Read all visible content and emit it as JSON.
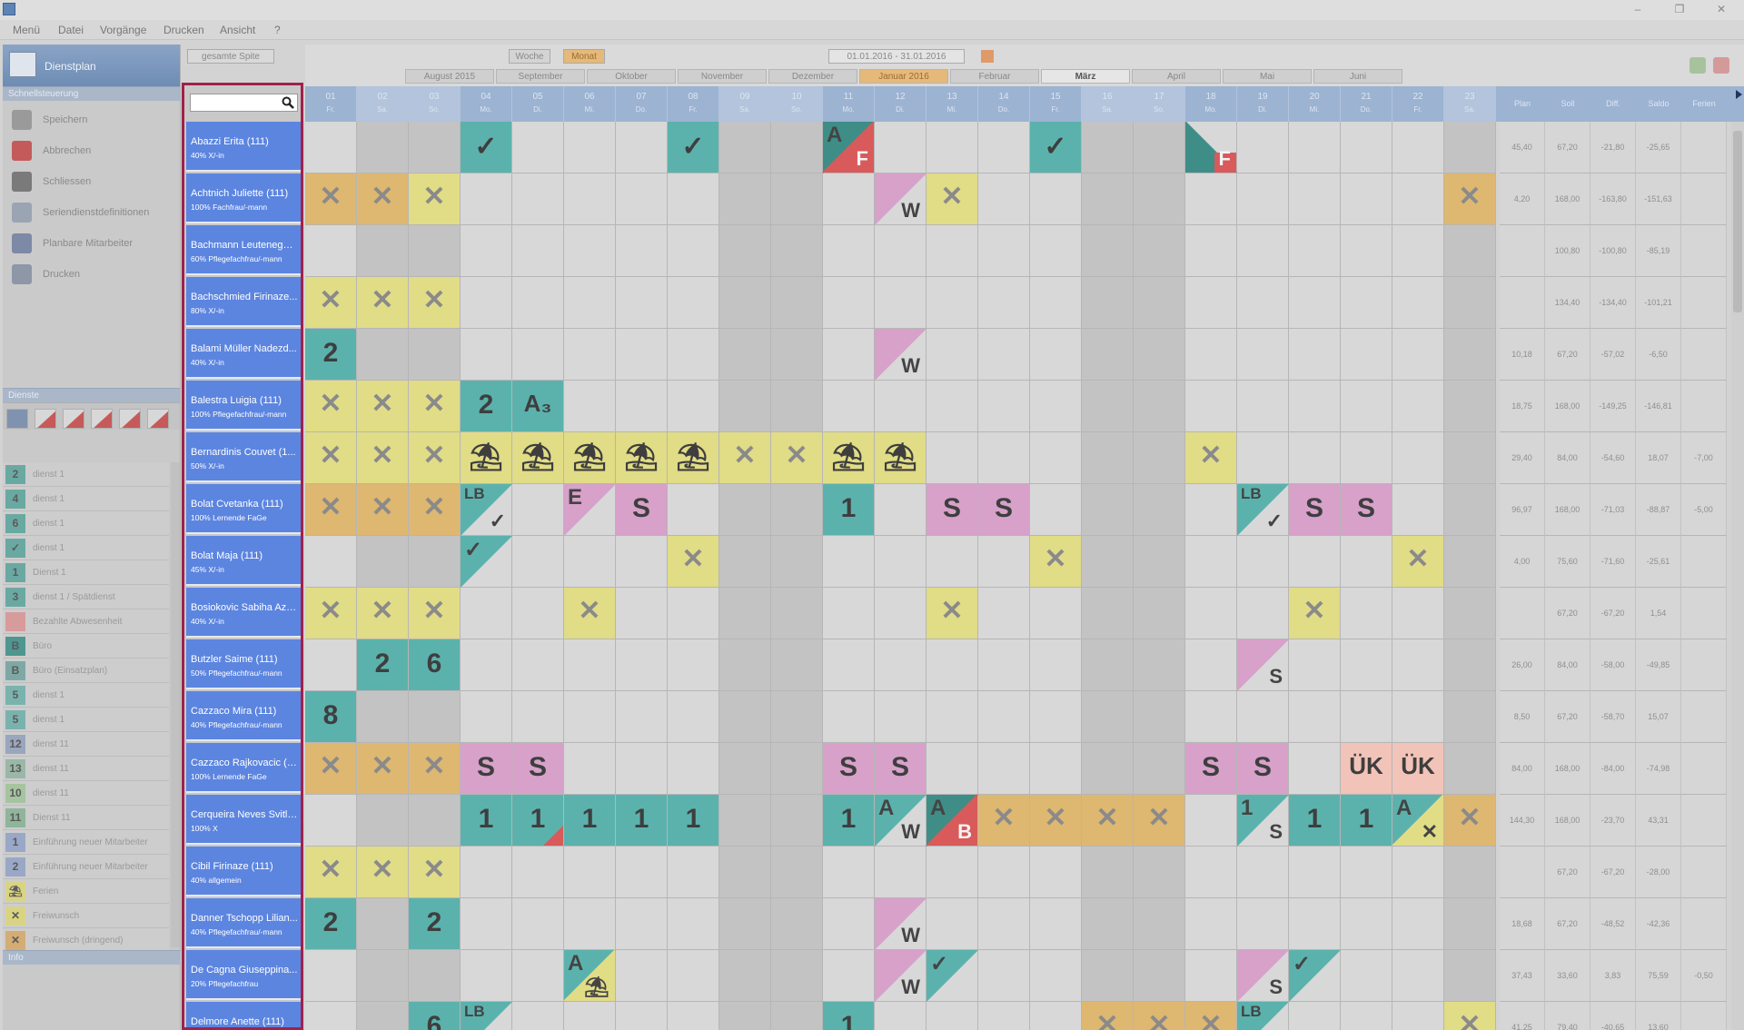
{
  "menu": [
    "Menü",
    "Datei",
    "Vorgänge",
    "Drucken",
    "Ansicht",
    "?"
  ],
  "window_controls": [
    "–",
    "❐",
    "✕"
  ],
  "sidebar": {
    "title": "Dienstplan",
    "section_quick": "Schnellsteuerung",
    "quick_items": [
      {
        "label": "Speichern",
        "icon": "save-icon",
        "color": "#9a9a9a"
      },
      {
        "label": "Abbrechen",
        "icon": "cancel-icon",
        "color": "#c55a5a"
      },
      {
        "label": "Schliessen",
        "icon": "close-icon",
        "color": "#7a7a7a"
      },
      {
        "label": "Seriendienstdefinitionen",
        "icon": "series-icon",
        "color": "#9aa4b3"
      },
      {
        "label": "Planbare Mitarbeiter",
        "icon": "employee-icon",
        "color": "#7d8aa6"
      },
      {
        "label": "Drucken",
        "icon": "print-icon",
        "color": "#8d97a8"
      }
    ],
    "section_services": "Dienste",
    "legend": [
      {
        "code": "2",
        "label": "dienst 1",
        "color": "#6aa9a2"
      },
      {
        "code": "4",
        "label": "dienst 1",
        "color": "#6aa9a2"
      },
      {
        "code": "6",
        "label": "dienst 1",
        "color": "#6aa9a2"
      },
      {
        "code": "✓",
        "label": "dienst 1",
        "color": "#6aa9a2"
      },
      {
        "code": "1",
        "label": "Dienst 1",
        "color": "#6aa9a2"
      },
      {
        "code": "3",
        "label": "dienst 1 / Spätdienst",
        "color": "#6aa9a2"
      },
      {
        "code": "",
        "label": "Bezahlte Abwesenheit",
        "color": "#d89b9b"
      },
      {
        "code": "B",
        "label": "Büro",
        "color": "#4f9690"
      },
      {
        "code": "B",
        "label": "Büro (Einsatzplan)",
        "color": "#7fa8a4"
      },
      {
        "code": "5",
        "label": "dienst 1",
        "color": "#7ab3ae"
      },
      {
        "code": "5",
        "label": "dienst 1",
        "color": "#7ab3ae"
      },
      {
        "code": "12",
        "label": "dienst 11",
        "color": "#9aa6bd"
      },
      {
        "code": "13",
        "label": "dienst 11",
        "color": "#9ab7a8"
      },
      {
        "code": "10",
        "label": "dienst 11",
        "color": "#a6c4a0"
      },
      {
        "code": "11",
        "label": "Dienst 11",
        "color": "#8fb59a"
      },
      {
        "code": "1",
        "label": "Einführung neuer Mitarbeiter",
        "color": "#9aa8c7"
      },
      {
        "code": "2",
        "label": "Einführung neuer Mitarbeiter",
        "color": "#9aa8c7"
      },
      {
        "code": "⛱",
        "label": "Ferien",
        "color": "#d9d483"
      },
      {
        "code": "✕",
        "label": "Freiwunsch",
        "color": "#d9d483"
      },
      {
        "code": "✕",
        "label": "Freiwunsch (dringend)",
        "color": "#d3ad74"
      }
    ],
    "section_info": "Info"
  },
  "filter": {
    "value": "gesamte Spite",
    "search_placeholder": ""
  },
  "views": {
    "week": "Woche",
    "month": "Monat",
    "date_range": "01.01.2016 - 31.01.2016"
  },
  "months": [
    "August 2015",
    "September",
    "Oktober",
    "November",
    "Dezember",
    "Januar 2016",
    "Februar",
    "März",
    "April",
    "Mai",
    "Juni"
  ],
  "days": [
    {
      "d": "01",
      "w": "Fr."
    },
    {
      "d": "02",
      "w": "Sa."
    },
    {
      "d": "03",
      "w": "So."
    },
    {
      "d": "04",
      "w": "Mo."
    },
    {
      "d": "05",
      "w": "Di."
    },
    {
      "d": "06",
      "w": "Mi."
    },
    {
      "d": "07",
      "w": "Do."
    },
    {
      "d": "08",
      "w": "Fr."
    },
    {
      "d": "09",
      "w": "Sa."
    },
    {
      "d": "10",
      "w": "So."
    },
    {
      "d": "11",
      "w": "Mo."
    },
    {
      "d": "12",
      "w": "Di."
    },
    {
      "d": "13",
      "w": "Mi."
    },
    {
      "d": "14",
      "w": "Do."
    },
    {
      "d": "15",
      "w": "Fr."
    },
    {
      "d": "16",
      "w": "Sa."
    },
    {
      "d": "17",
      "w": "So."
    },
    {
      "d": "18",
      "w": "Mo."
    },
    {
      "d": "19",
      "w": "Di."
    },
    {
      "d": "20",
      "w": "Mi."
    },
    {
      "d": "21",
      "w": "Do."
    },
    {
      "d": "22",
      "w": "Fr."
    },
    {
      "d": "23",
      "w": "Sa."
    }
  ],
  "summary_headers": [
    "Plan",
    "Soll",
    "Diff.",
    "Saldo",
    "Ferien"
  ],
  "colors": {
    "teal": "#5bb2ad",
    "yellow": "#e1dc86",
    "orange": "#deb770",
    "pink": "#d7a1ca",
    "salmon": "#f2c3b8",
    "darkteal": "#3e8e87",
    "red": "#d85a5a",
    "weekend": "#c3c3c3",
    "empty": "#d8d8d8",
    "header": "#9cb3d2",
    "name_bg": "#5c85e0",
    "highlight": "#a0214a"
  },
  "employees": [
    {
      "name": "Abazzi Erita (111)",
      "role": "40% X/-in",
      "summary": [
        "45,40",
        "67,20",
        "-21,80",
        "-25,65",
        ""
      ],
      "cells": {
        "3": "teal:✓",
        "7": "teal:✓",
        "10": "diag:darkteal:A:F",
        "14": "teal:✓",
        "17": "diag2:darkteal::F"
      }
    },
    {
      "name": "Achtnich Juliette (111)",
      "role": "100% Fachfrau/-mann",
      "summary": [
        "4,20",
        "168,00",
        "-163,80",
        "-151,63",
        ""
      ],
      "cells": {
        "0": "orange:✕",
        "1": "orange:✕",
        "2": "yellow:✕",
        "11": "diagp:pink::W",
        "12": "yellow:✕",
        "22": "orange:✕"
      }
    },
    {
      "name": "Bachmann Leuteneggar...",
      "role": "60% Pflegefachfrau/-mann",
      "summary": [
        "",
        "100,80",
        "-100,80",
        "-85,19",
        ""
      ],
      "cells": {}
    },
    {
      "name": "Bachschmied Firinaze...",
      "role": "80% X/-in",
      "summary": [
        "",
        "134,40",
        "-134,40",
        "-101,21",
        ""
      ],
      "cells": {
        "0": "yellow:✕",
        "1": "yellow:✕",
        "2": "yellow:✕"
      }
    },
    {
      "name": "Balami Müller Nadezd...",
      "role": "40% X/-in",
      "summary": [
        "10,18",
        "67,20",
        "-57,02",
        "-6,50",
        ""
      ],
      "cells": {
        "0": "teal:2",
        "11": "diagp:pink::W"
      }
    },
    {
      "name": "Balestra Luigia (111)",
      "role": "100% Pflegefachfrau/-mann",
      "summary": [
        "18,75",
        "168,00",
        "-149,25",
        "-146,81",
        ""
      ],
      "cells": {
        "0": "yellow:✕",
        "1": "yellow:✕",
        "2": "yellow:✕",
        "3": "teal:2",
        "4": "teal:A₃"
      }
    },
    {
      "name": "Bernardinis Couvet (1...",
      "role": "50% X/-in",
      "summary": [
        "29,40",
        "84,00",
        "-54,60",
        "18,07",
        "-7,00"
      ],
      "cells": {
        "0": "yellow:✕",
        "1": "yellow:✕",
        "2": "yellow:✕",
        "3": "yellow:⛱",
        "4": "yellow:⛱",
        "5": "yellow:⛱",
        "6": "yellow:⛱",
        "7": "yellow:⛱",
        "8": "yellow:✕",
        "9": "yellow:✕",
        "10": "yellow:⛱",
        "11": "yellow:⛱",
        "17": "yellow:✕"
      }
    },
    {
      "name": "Bolat Cvetanka (111)",
      "role": "100% Lernende FaGe",
      "summary": [
        "96,97",
        "168,00",
        "-71,03",
        "-88,87",
        "-5,00"
      ],
      "cells": {
        "0": "orange:✕",
        "1": "orange:✕",
        "2": "orange:✕",
        "3": "diagp:teal:LB:✓",
        "5": "diagp:pink:E:",
        "6": "pink:S",
        "10": "teal:1",
        "12": "pink:S",
        "13": "pink:S",
        "18": "diagp:teal:LB:✓",
        "19": "pink:S",
        "20": "pink:S"
      }
    },
    {
      "name": "Bolat Maja (111)",
      "role": "45% X/-in",
      "summary": [
        "4,00",
        "75,60",
        "-71,60",
        "-25,61",
        ""
      ],
      "cells": {
        "3": "diagp:teal:✓:",
        "7": "yellow:✕",
        "14": "yellow:✕",
        "21": "yellow:✕"
      }
    },
    {
      "name": "Bosiokovic Sabiha Aziz...",
      "role": "40% X/-in",
      "summary": [
        "",
        "67,20",
        "-67,20",
        "1,54",
        ""
      ],
      "cells": {
        "0": "yellow:✕",
        "1": "yellow:✕",
        "2": "yellow:✕",
        "5": "yellow:✕",
        "12": "yellow:✕",
        "19": "yellow:✕"
      }
    },
    {
      "name": "Butzler Saime (111)",
      "role": "50% Pflegefachfrau/-mann",
      "summary": [
        "26,00",
        "84,00",
        "-58,00",
        "-49,85",
        ""
      ],
      "cells": {
        "1": "teal:2",
        "2": "teal:6",
        "18": "diagp:pink::S"
      }
    },
    {
      "name": "Cazzaco Mira (111)",
      "role": "40% Pflegefachfrau/-mann",
      "summary": [
        "8,50",
        "67,20",
        "-58,70",
        "15,07",
        ""
      ],
      "cells": {
        "0": "teal:8"
      }
    },
    {
      "name": "Cazzaco Rajkovacic (1...",
      "role": "100% Lernende FaGe",
      "summary": [
        "84,00",
        "168,00",
        "-84,00",
        "-74,98",
        ""
      ],
      "cells": {
        "0": "orange:✕",
        "1": "orange:✕",
        "2": "orange:✕",
        "3": "pink:S",
        "4": "pink:S",
        "10": "pink:S",
        "11": "pink:S",
        "17": "pink:S",
        "18": "pink:S",
        "20": "salmon:ÜK",
        "21": "salmon:ÜK"
      }
    },
    {
      "name": "Cerqueira Neves Svitla...",
      "role": "100% X",
      "summary": [
        "144,30",
        "168,00",
        "-23,70",
        "43,31",
        ""
      ],
      "cells": {
        "3": "teal:1",
        "4": "tealred:1",
        "5": "teal:1",
        "6": "teal:1",
        "7": "teal:1",
        "10": "teal:1",
        "11": "diagp:teal:A:W",
        "12": "diag:darkteal:A:B",
        "13": "orange:✕",
        "14": "orange:✕",
        "15": "orange:✕",
        "16": "orange:✕",
        "18": "diagp:teal:1:S",
        "19": "teal:1",
        "20": "teal:1",
        "21": "diagy:teal:A:✕",
        "22": "orange:✕"
      }
    },
    {
      "name": "Cibil Firinaze  (111)",
      "role": "40% allgemein",
      "summary": [
        "",
        "67,20",
        "-67,20",
        "-28,00",
        ""
      ],
      "cells": {
        "0": "yellow:✕",
        "1": "yellow:✕",
        "2": "yellow:✕"
      }
    },
    {
      "name": "Danner Tschopp Lilian...",
      "role": "40% Pflegefachfrau/-mann",
      "summary": [
        "18,68",
        "67,20",
        "-48,52",
        "-42,36",
        ""
      ],
      "cells": {
        "0": "teal:2",
        "2": "teal:2",
        "11": "diagp:pink::W"
      }
    },
    {
      "name": "De Cagna Giuseppina...",
      "role": "20% Pflegefachfrau",
      "summary": [
        "37,43",
        "33,60",
        "3,83",
        "75,59",
        "-0,50"
      ],
      "cells": {
        "5": "diagy:teal:A:⛱",
        "11": "diagp:pink::W",
        "12": "diagp:teal:✓:",
        "18": "diagp:pink::S",
        "19": "diagp:teal:✓:"
      }
    },
    {
      "name": "Delmore Anette (111)",
      "role": "",
      "summary": [
        "41,25",
        "79,40",
        "-40,65",
        "13,60",
        ""
      ],
      "cells": {
        "2": "teal:6",
        "3": "diagp:teal:LB:",
        "10": "teal:1",
        "15": "orange:✕",
        "16": "orange:✕",
        "17": "orange:✕",
        "18": "diagp:teal:LB:",
        "22": "yellow:✕"
      }
    }
  ]
}
